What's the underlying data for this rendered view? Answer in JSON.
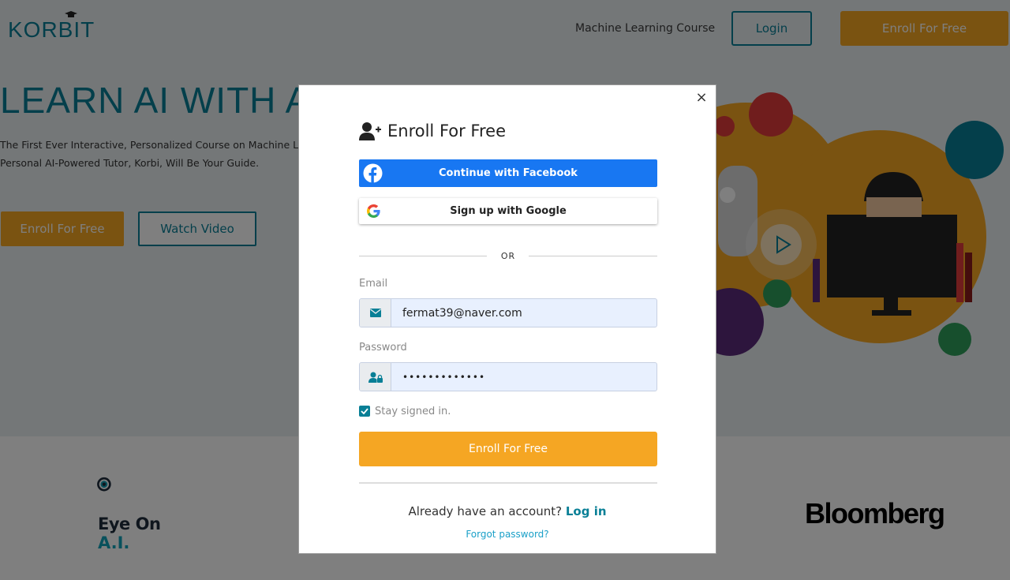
{
  "nav": {
    "brand": "KORBIT",
    "link": "Machine Learning Course",
    "login": "Login",
    "enroll": "Enroll For Free"
  },
  "hero": {
    "title": "LEARN AI WITH AN",
    "subtitle_line1": "The First Ever Interactive, Personalized Course on Machine Learnin",
    "subtitle_line2": "Personal AI-Powered Tutor, Korbi, Will Be Your Guide.",
    "enroll": "Enroll For Free",
    "watch": "Watch Video"
  },
  "logos": {
    "eye_line1": "Eye On",
    "eye_line2": "A.I.",
    "bloomberg": "Bloomberg"
  },
  "modal": {
    "close": "×",
    "title": "Enroll For Free",
    "facebook": "Continue with Facebook",
    "google": "Sign up with Google",
    "or": "OR",
    "email_label": "Email",
    "email_value": "fermat39@naver.com",
    "password_label": "Password",
    "password_value": "•••••••••••••",
    "stay_signed": "Stay signed in.",
    "submit": "Enroll For Free",
    "already": "Already have an account?",
    "login_link": "Log in",
    "forgot": "Forgot password?"
  },
  "colors": {
    "brand": "#087f96",
    "accent": "#f5a623",
    "facebook": "#1877f2"
  }
}
